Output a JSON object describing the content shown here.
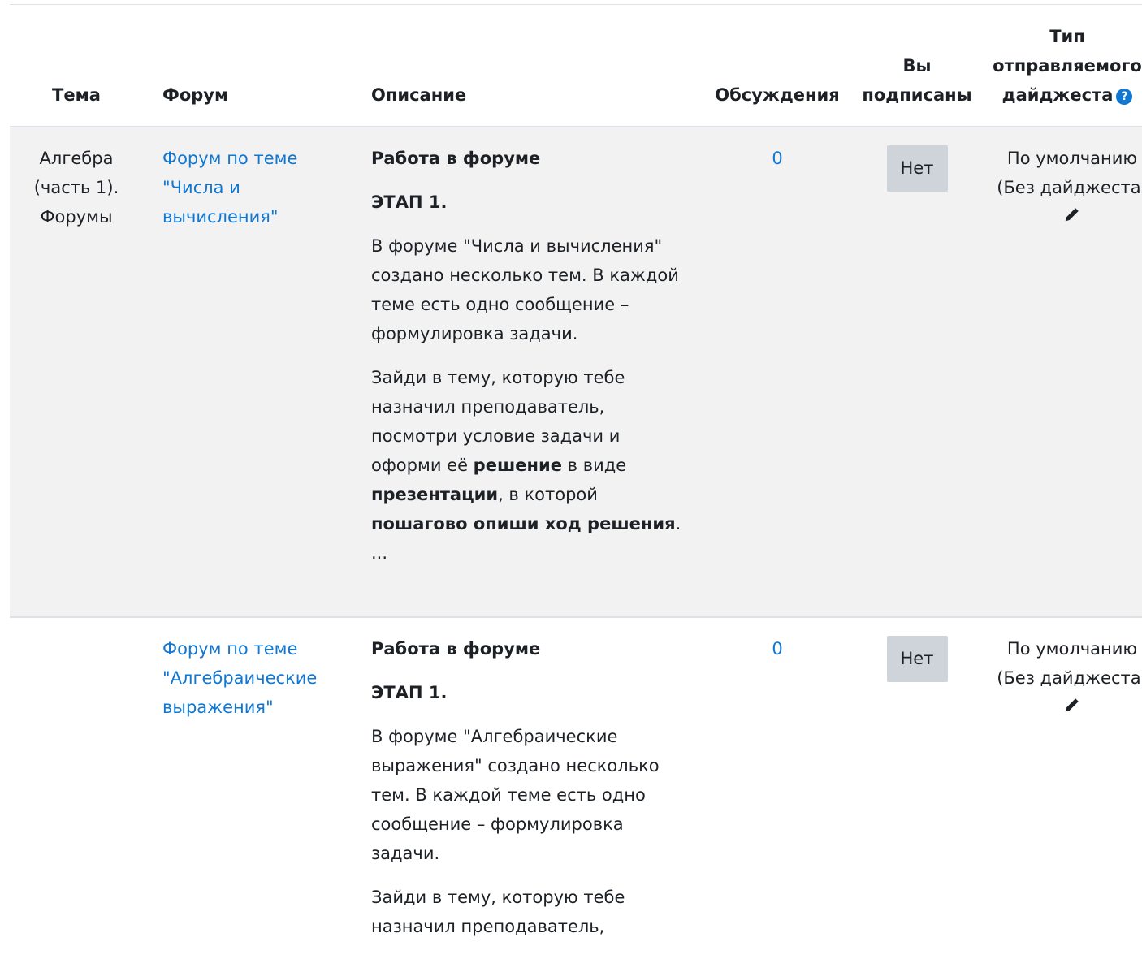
{
  "table": {
    "headers": {
      "tema": "Тема",
      "forum": "Форум",
      "description": "Описание",
      "discussions": "Обсуждения",
      "subscribed": [
        "Вы",
        "подписаны"
      ],
      "digest": [
        "Тип",
        "отправляемого",
        "дайджеста"
      ]
    },
    "rows": [
      {
        "topic": [
          "Алгебра",
          "(часть 1).",
          "Форумы"
        ],
        "forum_link": [
          "Форум по теме",
          "\"Числа и",
          "вычисления\""
        ],
        "desc_title": "Работа в форуме",
        "desc_stage": "ЭТАП 1.",
        "desc_p1": [
          "В форуме \"Числа и вычисления\"",
          "создано несколько тем. В каждой",
          "теме есть одно сообщение –",
          "формулировка задачи."
        ],
        "desc_p2": {
          "l1": "Зайди в тему, которую тебе",
          "l2": "назначил преподаватель,",
          "l3": "посмотри условие задачи и",
          "l4a": "оформи её ",
          "l4b": "решение",
          "l4c": " в виде",
          "l5a": "презентации",
          "l5b": ", в которой",
          "l6a": "пошагово опиши ход решения",
          "l6b": ".",
          "ellipsis": "..."
        },
        "discussions": "0",
        "subscribe_button": "Нет",
        "digest": [
          "По умолчанию",
          "(Без дайджеста)"
        ]
      },
      {
        "topic": [],
        "forum_link": [
          "Форум по теме",
          "\"Алгебраические",
          "выражения\""
        ],
        "desc_title": "Работа в форуме",
        "desc_stage": "ЭТАП 1.",
        "desc_p1": [
          "В форуме \"Алгебраические",
          "выражения\" создано несколько",
          "тем. В каждой теме есть одно",
          "сообщение – формулировка",
          "задачи."
        ],
        "desc_p2": {
          "l1": "Зайди в тему, которую тебе",
          "l2": "назначил преподаватель,"
        },
        "discussions": "0",
        "subscribe_button": "Нет",
        "digest": [
          "По умолчанию",
          "(Без дайджеста)"
        ]
      }
    ]
  },
  "icons": {
    "help": "help-question-icon",
    "edit": "pencil-icon"
  },
  "colors": {
    "link": "#1177d1",
    "row_shade": "#f2f2f2",
    "button": "#ced4da",
    "help": "#1177d1"
  }
}
